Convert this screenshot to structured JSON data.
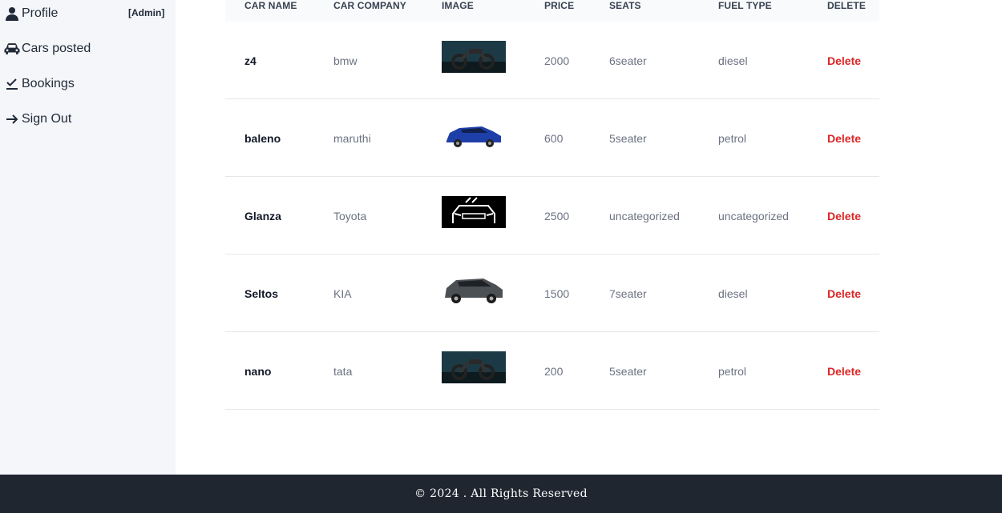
{
  "sidebar": {
    "items": [
      {
        "label": "Profile",
        "icon": "person-icon"
      },
      {
        "label": "Cars posted",
        "icon": "car-icon"
      },
      {
        "label": "Bookings",
        "icon": "checkmark-icon"
      },
      {
        "label": "Sign Out",
        "icon": "arrow-right-icon"
      }
    ],
    "role_badge": "[Admin]"
  },
  "table": {
    "headers": {
      "name": "CAR NAME",
      "company": "CAR COMPANY",
      "image": "IMAGE",
      "price": "PRICE",
      "seats": "SEATS",
      "fuel": "FUEL TYPE",
      "delete": "DELETE"
    },
    "rows": [
      {
        "name": "z4",
        "company": "bmw",
        "image": "motorcycle-photo",
        "price": "2000",
        "seats": "6seater",
        "fuel": "diesel",
        "delete": "Delete"
      },
      {
        "name": "baleno",
        "company": "maruthi",
        "image": "blue-suv-photo",
        "price": "600",
        "seats": "5seater",
        "fuel": "petrol",
        "delete": "Delete"
      },
      {
        "name": "Glanza",
        "company": "Toyota",
        "image": "car-front-logo",
        "price": "2500",
        "seats": "uncategorized",
        "fuel": "uncategorized",
        "delete": "Delete"
      },
      {
        "name": "Seltos",
        "company": "KIA",
        "image": "grey-suv-photo",
        "price": "1500",
        "seats": "7seater",
        "fuel": "diesel",
        "delete": "Delete"
      },
      {
        "name": "nano",
        "company": "tata",
        "image": "motorcycle-photo",
        "price": "200",
        "seats": "5seater",
        "fuel": "petrol",
        "delete": "Delete"
      }
    ]
  },
  "footer": {
    "text": "© 2024 . All Rights Reserved"
  },
  "colors": {
    "sidebar_bg": "#f5f6fa",
    "footer_bg": "#1f2630",
    "delete_red": "#dc2626"
  }
}
